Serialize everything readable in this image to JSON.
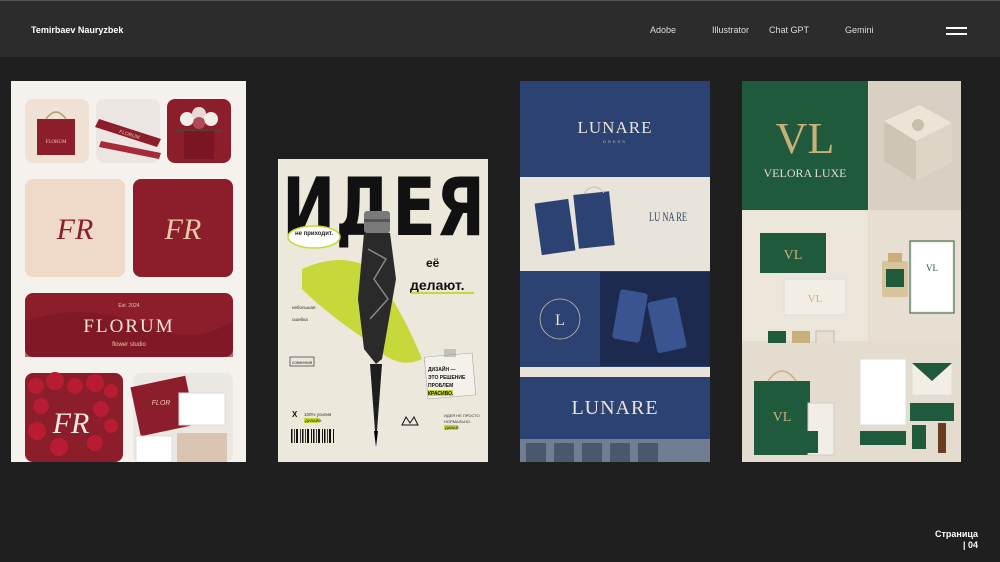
{
  "header": {
    "author": "Temirbaev Nauryzbek",
    "nav": [
      "Adobe",
      "Illustrator",
      "Chat GPT",
      "Gemini"
    ],
    "menu_icon": "hamburger-icon"
  },
  "florum": {
    "brand": "FLORUM",
    "est": "Est. 2024",
    "tagline": "flower studio",
    "monogram": "FR",
    "ribbon": "FLORUM",
    "bag_text": "FLORUM",
    "card_text": "FLOR",
    "colors": {
      "primary": "#8c1d2b",
      "cream": "#efe1d4"
    }
  },
  "idea": {
    "headline": "ИДЕЯ",
    "bubble": "не приходит.",
    "lettering1": "её",
    "lettering2": "делают.",
    "note": "ДИЗАЙН — ЭТО РЕШЕНИЕ ПРОБЛЕМ КРАСИВО.",
    "small1": "небольшая",
    "small2": "ошибка",
    "small3": "сомнения",
    "footer1": "100% усилия",
    "footer2": "ДИЗАЙН",
    "side_note": "ИДЕЯ НЕ ПРОСТО НОРМАЛЬНО. ДАВАЙ.",
    "colors": {
      "accent": "#c7d83a",
      "paper": "#ece8dc"
    }
  },
  "lunare": {
    "brand": "LUNARE",
    "sub": "DRESS",
    "monogram": "LU NA RE",
    "badge": "L",
    "colors": {
      "primary": "#2c4272",
      "cream": "#e9e4da"
    }
  },
  "velora": {
    "brand": "VELORA LUXE",
    "monogram": "VL",
    "colors": {
      "primary": "#1f5a3c",
      "cream": "#e3dccf",
      "gold": "#c9b07a"
    }
  },
  "footer": {
    "page_label": "Страница",
    "page_number": "| 04"
  }
}
